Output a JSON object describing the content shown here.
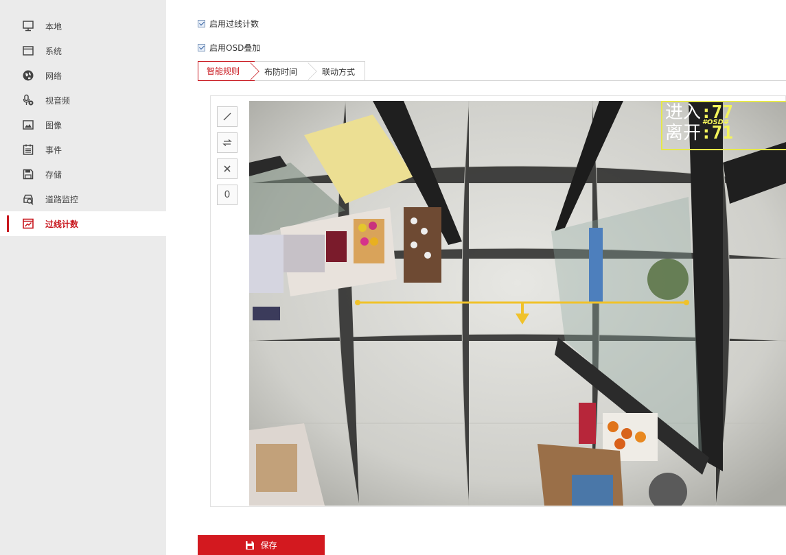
{
  "sidebar": {
    "items": [
      {
        "label": "本地",
        "icon": "monitor-icon"
      },
      {
        "label": "系统",
        "icon": "window-icon"
      },
      {
        "label": "网络",
        "icon": "globe-icon"
      },
      {
        "label": "视音频",
        "icon": "microphone-icon"
      },
      {
        "label": "图像",
        "icon": "image-icon"
      },
      {
        "label": "事件",
        "icon": "calendar-icon"
      },
      {
        "label": "存储",
        "icon": "save-disk-icon"
      },
      {
        "label": "道路监控",
        "icon": "car-search-icon"
      },
      {
        "label": "过线计数",
        "icon": "line-count-icon",
        "active": true
      }
    ]
  },
  "options": {
    "enable_count_label": "启用过线计数",
    "enable_count_checked": true,
    "enable_osd_label": "启用OSD叠加",
    "enable_osd_checked": true
  },
  "tabs": [
    {
      "label": "智能规则",
      "active": true
    },
    {
      "label": "布防时间"
    },
    {
      "label": "联动方式"
    }
  ],
  "tools": [
    {
      "name": "draw-line-tool",
      "glyph": "／"
    },
    {
      "name": "swap-direction-tool",
      "glyph": "⇌"
    },
    {
      "name": "clear-tool",
      "glyph": "✕"
    },
    {
      "name": "reset-count-tool",
      "glyph": "0"
    }
  ],
  "osd": {
    "enter_label": "进入",
    "enter_value": ":77",
    "leave_label": "离开",
    "leave_value": ":71",
    "mark": "#OSD#"
  },
  "save": {
    "label": "保存"
  },
  "colors": {
    "accent": "#c8161d",
    "osd_border": "#e6e84a",
    "count_line": "#f0c22a"
  }
}
